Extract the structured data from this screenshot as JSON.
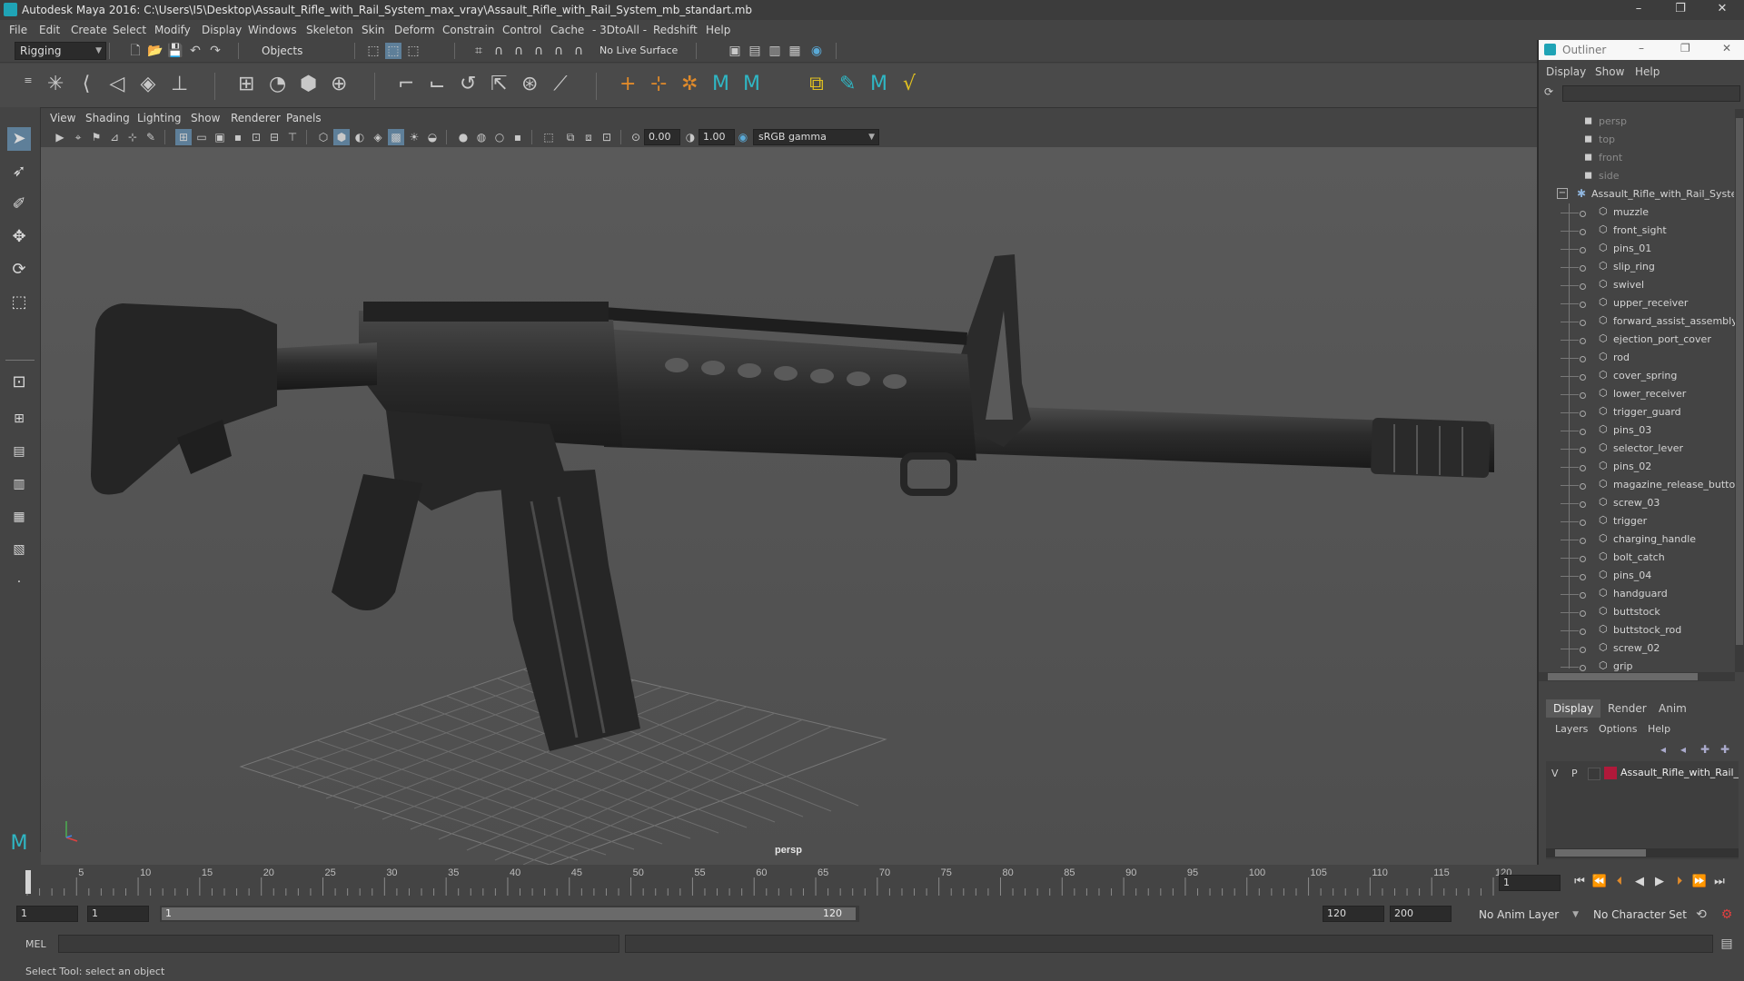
{
  "window": {
    "title": "Autodesk Maya 2016: C:\\Users\\I5\\Desktop\\Assault_Rifle_with_Rail_System_max_vray\\Assault_Rifle_with_Rail_System_mb_standart.mb",
    "minimize": "–",
    "maximize": "❐",
    "close": "✕"
  },
  "menubar": [
    "File",
    "Edit",
    "Create",
    "Select",
    "Modify",
    "Display",
    "Windows",
    "Skeleton",
    "Skin",
    "Deform",
    "Constrain",
    "Control",
    "Cache",
    "- 3DtoAll -",
    "Redshift",
    "Help"
  ],
  "toolbar": {
    "mode": "Rigging",
    "objects": "Objects",
    "live_surface": "No Live Surface"
  },
  "viewport": {
    "menu": [
      "View",
      "Shading",
      "Lighting",
      "Show",
      "Renderer",
      "Panels"
    ],
    "exposure": "0.00",
    "gamma": "1.00",
    "colorspace": "sRGB gamma",
    "camera_label": "persp"
  },
  "outliner": {
    "title": "Outliner",
    "menu": [
      "Display",
      "Show",
      "Help"
    ],
    "cameras": [
      "persp",
      "top",
      "front",
      "side"
    ],
    "root": "Assault_Rifle_with_Rail_System",
    "children": [
      "muzzle",
      "front_sight",
      "pins_01",
      "slip_ring",
      "swivel",
      "upper_receiver",
      "forward_assist_assembly",
      "ejection_port_cover",
      "rod",
      "cover_spring",
      "lower_receiver",
      "trigger_guard",
      "pins_03",
      "selector_lever",
      "pins_02",
      "magazine_release_button",
      "screw_03",
      "trigger",
      "charging_handle",
      "bolt_catch",
      "pins_04",
      "handguard",
      "buttstock",
      "buttstock_rod",
      "screw_02",
      "grip"
    ]
  },
  "layers": {
    "tabs": [
      "Display",
      "Render",
      "Anim"
    ],
    "menu": [
      "Layers",
      "Options",
      "Help"
    ],
    "rows": [
      {
        "v": "V",
        "p": "P",
        "name": "Assault_Rifle_with_Rail_System",
        "color": "#b0193a"
      }
    ]
  },
  "timeline": {
    "ticks": [
      "1",
      "5",
      "10",
      "15",
      "20",
      "25",
      "30",
      "35",
      "40",
      "45",
      "50",
      "55",
      "60",
      "65",
      "70",
      "75",
      "80",
      "85",
      "90",
      "95",
      "100",
      "105",
      "110",
      "115",
      "120"
    ],
    "current_frame": "1"
  },
  "range": {
    "start": "1",
    "start2": "1",
    "slider_start": "1",
    "slider_end": "120",
    "end": "120",
    "end2": "200",
    "anim_layer": "No Anim Layer",
    "char_set": "No Character Set"
  },
  "cmdline": {
    "lang": "MEL"
  },
  "status": {
    "help": "Select Tool: select an object"
  },
  "colors": {
    "accent": "#5aa9d6",
    "layer_red": "#b0193a"
  }
}
